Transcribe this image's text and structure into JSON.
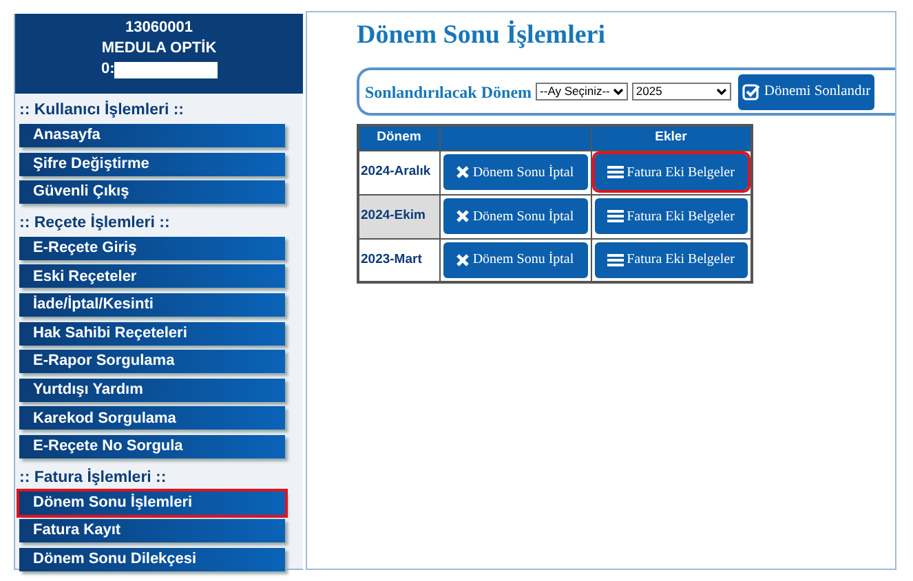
{
  "sidebar": {
    "header": {
      "code": "13060001",
      "name": "MEDULA OPTİK",
      "user_label": "0:"
    },
    "sections": [
      {
        "title": ":: Kullanıcı İşlemleri ::",
        "items": [
          {
            "label": "Anasayfa",
            "highlighted": false
          },
          {
            "label": "Şifre Değiştirme",
            "highlighted": false
          },
          {
            "label": "Güvenli Çıkış",
            "highlighted": false
          }
        ]
      },
      {
        "title": ":: Reçete İşlemleri ::",
        "items": [
          {
            "label": "E-Reçete Giriş",
            "highlighted": false
          },
          {
            "label": "Eski Reçeteler",
            "highlighted": false
          },
          {
            "label": "İade/İptal/Kesinti",
            "highlighted": false
          },
          {
            "label": "Hak Sahibi Reçeteleri",
            "highlighted": false
          },
          {
            "label": "E-Rapor Sorgulama",
            "highlighted": false
          },
          {
            "label": "Yurtdışı Yardım",
            "highlighted": false
          },
          {
            "label": "Karekod Sorgulama",
            "highlighted": false
          },
          {
            "label": "E-Reçete No Sorgula",
            "highlighted": false
          }
        ]
      },
      {
        "title": ":: Fatura İşlemleri ::",
        "items": [
          {
            "label": "Dönem Sonu İşlemleri",
            "highlighted": true
          },
          {
            "label": "Fatura Kayıt",
            "highlighted": false
          },
          {
            "label": "Dönem Sonu Dilekçesi",
            "highlighted": false
          }
        ]
      }
    ]
  },
  "main": {
    "title": "Dönem Sonu İşlemleri",
    "filter": {
      "label": "Sonlandırılacak Dönem",
      "month_select": "--Ay Seçiniz--",
      "year_select": "2025",
      "submit": "Dönemi Sonlandır"
    },
    "table": {
      "columns": [
        "Dönem",
        "Ekler"
      ],
      "rows": [
        {
          "period": "2024-Aralık",
          "shaded": false,
          "cancel": "Dönem Sonu İptal",
          "attachments": "Fatura Eki Belgeler",
          "highlighted": true
        },
        {
          "period": "2024-Ekim",
          "shaded": true,
          "cancel": "Dönem Sonu İptal",
          "attachments": "Fatura Eki Belgeler",
          "highlighted": false
        },
        {
          "period": "2023-Mart",
          "shaded": false,
          "cancel": "Dönem Sonu İptal",
          "attachments": "Fatura Eki Belgeler",
          "highlighted": false
        }
      ]
    }
  }
}
